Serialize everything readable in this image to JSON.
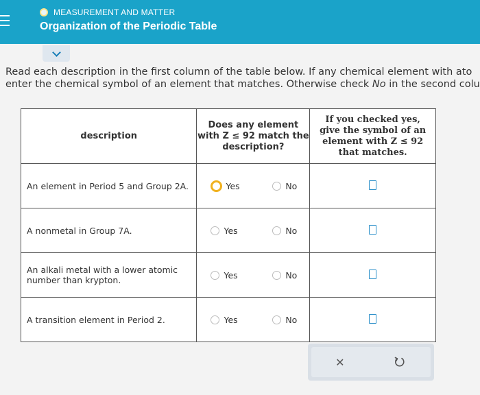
{
  "header": {
    "topic": "MEASUREMENT AND MATTER",
    "title": "Organization of the Periodic Table"
  },
  "instructions": {
    "line1": "Read each description in the first column of the table below. If any chemical element with ato",
    "line2_pre": "enter the chemical symbol of an element that matches. Otherwise check ",
    "line2_em": "No",
    "line2_post": " in the second colu"
  },
  "table": {
    "headers": {
      "description": "description",
      "any_element": "Does any element with Z ≤ 92 match the description?",
      "symbol": "If you checked yes, give the symbol of an element with Z ≤ 92 that matches."
    },
    "yes_label": "Yes",
    "no_label": "No",
    "rows": [
      {
        "description": "An element in Period 5 and Group 2A.",
        "selected": "yes"
      },
      {
        "description": "A nonmetal in Group 7A.",
        "selected": "none"
      },
      {
        "description": "An alkali metal with a lower atomic number than krypton.",
        "selected": "none"
      },
      {
        "description": "A transition element in Period 2.",
        "selected": "none"
      }
    ]
  },
  "actions": {
    "clear_icon": "x-icon",
    "undo_icon": "undo-icon"
  }
}
